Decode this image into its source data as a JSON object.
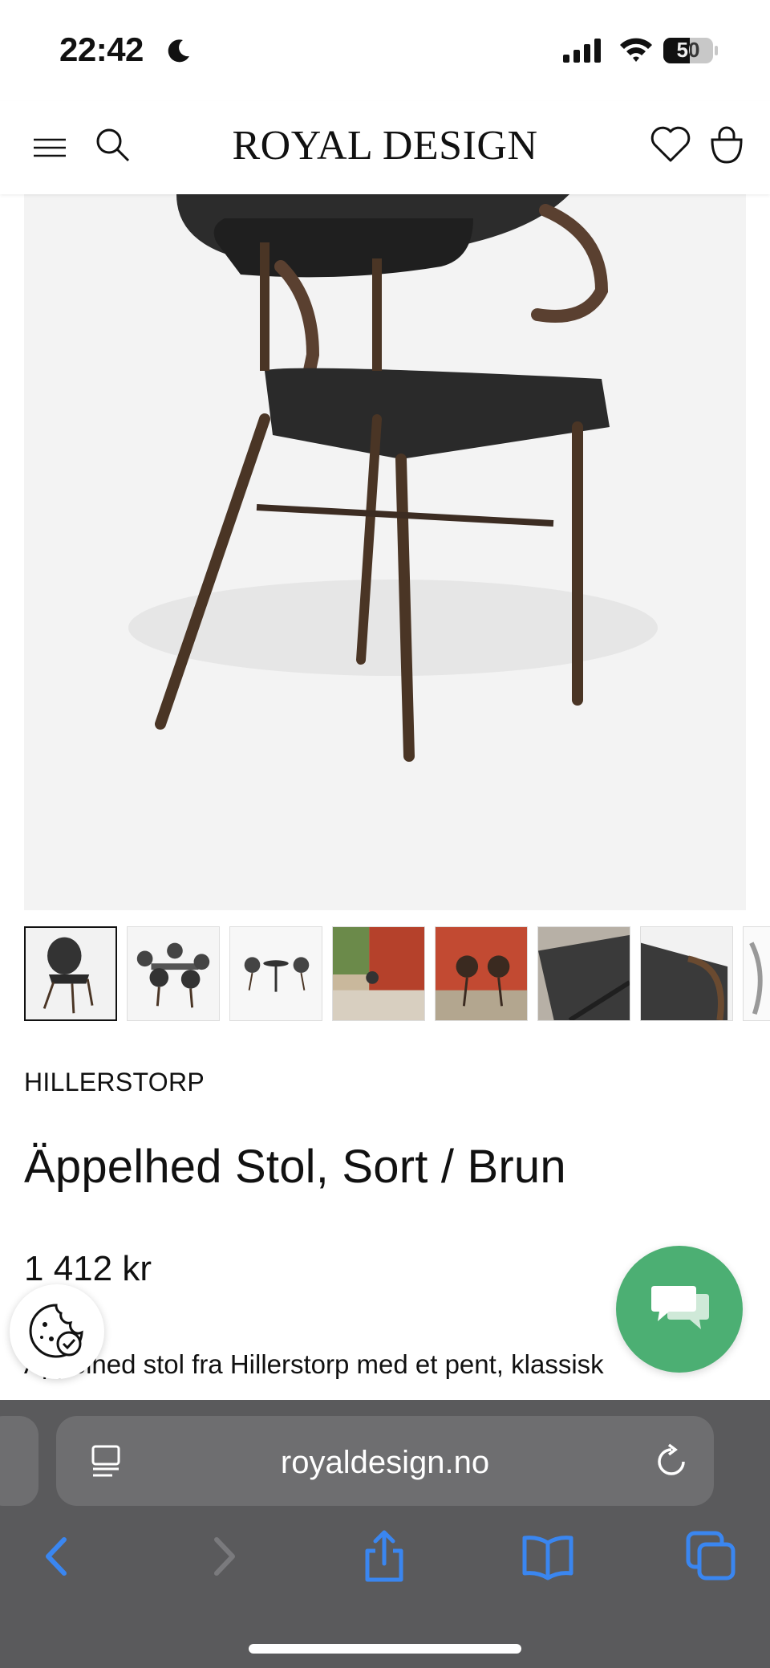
{
  "status_bar": {
    "time": "22:42",
    "battery": "50"
  },
  "header": {
    "brand": "ROYAL DESIGN"
  },
  "product": {
    "brand_name": "HILLERSTORP",
    "title": "Äppelhed Stol, Sort / Brun",
    "price": "1 412 kr",
    "description": "Äppelhed stol fra Hillerstorp med et pent, klassisk"
  },
  "thumbnails": [
    {
      "name": "chair-front",
      "active": true
    },
    {
      "name": "dining-set"
    },
    {
      "name": "bistro-set"
    },
    {
      "name": "red-wall-scene"
    },
    {
      "name": "outdoor-chairs"
    },
    {
      "name": "seat-detail"
    },
    {
      "name": "arm-detail"
    },
    {
      "name": "partial"
    }
  ],
  "browser": {
    "url": "royaldesign.no"
  },
  "colors": {
    "chat_green": "#4caf73",
    "browser_gray": "#5a5a5c",
    "toolbar_blue": "#3a86f0"
  }
}
